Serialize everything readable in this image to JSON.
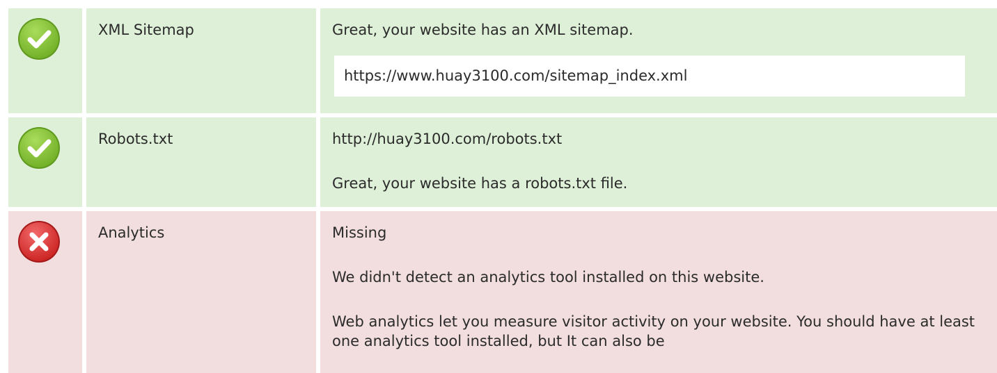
{
  "colors": {
    "pass_background": "#dff0d8",
    "fail_background": "#f2dede",
    "pass_icon": "#8cc63e",
    "fail_icon": "#e03b3b"
  },
  "rows": [
    {
      "status": "pass",
      "icon": "check-icon",
      "name": "XML Sitemap",
      "lines": [
        "Great, your website has an XML sitemap."
      ],
      "url": "https://www.huay3100.com/sitemap_index.xml"
    },
    {
      "status": "pass",
      "icon": "check-icon",
      "name": "Robots.txt",
      "lines": [
        "http://huay3100.com/robots.txt",
        "Great, your website has a robots.txt file."
      ]
    },
    {
      "status": "fail",
      "icon": "cross-icon",
      "name": "Analytics",
      "lines": [
        "Missing",
        "We didn't detect an analytics tool installed on this website.",
        "Web analytics let you measure visitor activity on your website. You should have at least one analytics tool installed, but It can also be"
      ]
    }
  ]
}
